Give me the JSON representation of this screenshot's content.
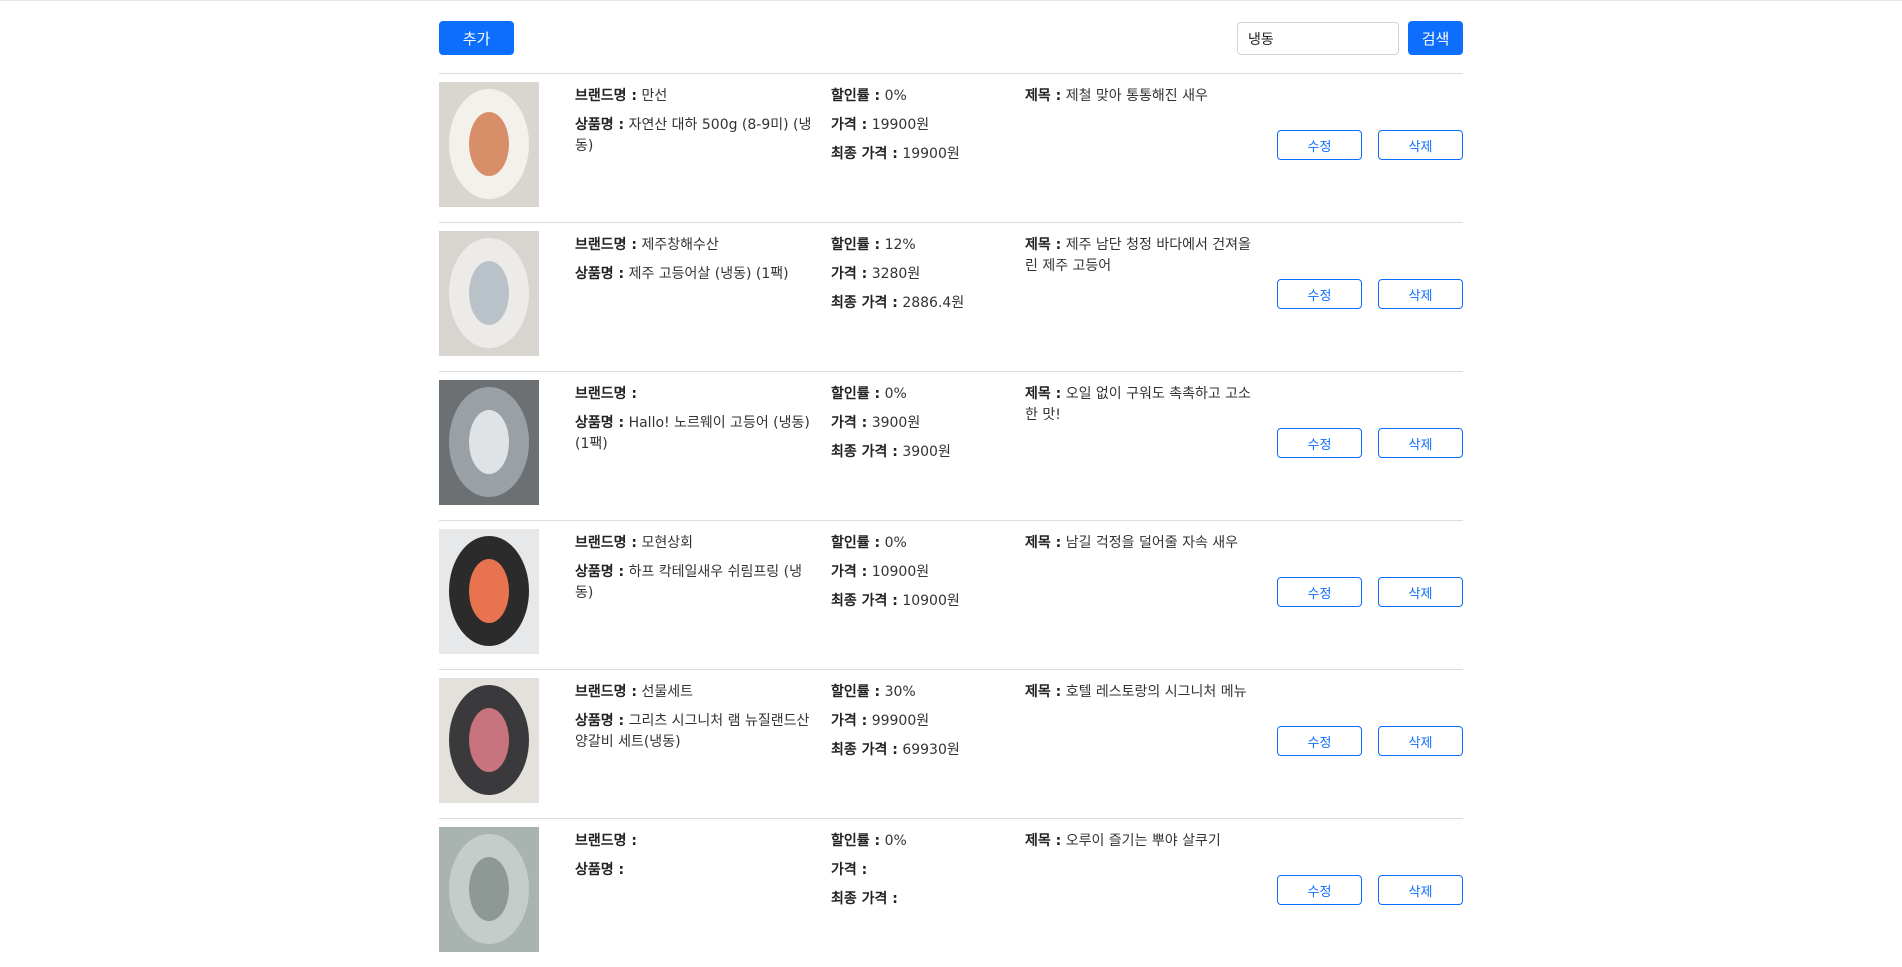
{
  "toolbar": {
    "add_label": "추가",
    "search_value": "냉동",
    "search_label": "검색"
  },
  "labels": {
    "brand": "브랜드명 :",
    "name": "상품명 :",
    "discount": "할인률 :",
    "price": "가격 :",
    "final_price": "최종 가격 :",
    "title": "제목 :",
    "edit": "수정",
    "delete": "삭제"
  },
  "products": [
    {
      "brand": "만선",
      "name": "자연산 대하 500g (8-9미) (냉동)",
      "discount": "0%",
      "price": "19900원",
      "final_price": "19900원",
      "title": "제철 맞아 통통해진 새우",
      "image": "shrimp-plate",
      "colors": {
        "bg": "#d9d6d0",
        "plate": "#f3f1ec",
        "food": "#d98e6a"
      }
    },
    {
      "brand": "제주창해수산",
      "name": "제주 고등어살 (냉동) (1팩)",
      "discount": "12%",
      "price": "3280원",
      "final_price": "2886.4원",
      "title": "제주 남단 청정 바다에서 건져올린 제주 고등어",
      "image": "mackerel-plate",
      "colors": {
        "bg": "#d8d5d0",
        "plate": "#ecebe8",
        "food": "#b9c2c9"
      }
    },
    {
      "brand": "",
      "name": "Hallo! 노르웨이 고등어 (냉동) (1팩)",
      "discount": "0%",
      "price": "3900원",
      "final_price": "3900원",
      "title": "오일 없이 구워도 촉촉하고 고소한 맛!",
      "image": "mackerel-ice",
      "colors": {
        "bg": "#6d7073",
        "plate": "#9aa1a6",
        "food": "#dfe3e6"
      }
    },
    {
      "brand": "모현상회",
      "name": "하프 칵테일새우 쉬림프링 (냉동)",
      "discount": "0%",
      "price": "10900원",
      "final_price": "10900원",
      "title": "남길 걱정을 덜어줄 자속 새우",
      "image": "shrimp-ring",
      "colors": {
        "bg": "#e6e8ea",
        "plate": "#2b2b2b",
        "food": "#e8744f"
      }
    },
    {
      "brand": "선물세트",
      "name": "그리츠 시그니처 램 뉴질랜드산 양갈비 세트(냉동)",
      "discount": "30%",
      "price": "99900원",
      "final_price": "69930원",
      "title": "호텔 레스토랑의 시그니처 메뉴",
      "image": "lamb-set",
      "colors": {
        "bg": "#e4e1dc",
        "plate": "#3a3a3c",
        "food": "#c9737e"
      }
    },
    {
      "brand": "",
      "name": "",
      "discount": "0%",
      "price": "",
      "final_price": "",
      "title": "오루이 즐기는 뿌야 살쿠기",
      "image": "partial",
      "colors": {
        "bg": "#a9b3b0",
        "plate": "#c5ccc9",
        "food": "#8e9995"
      }
    }
  ]
}
